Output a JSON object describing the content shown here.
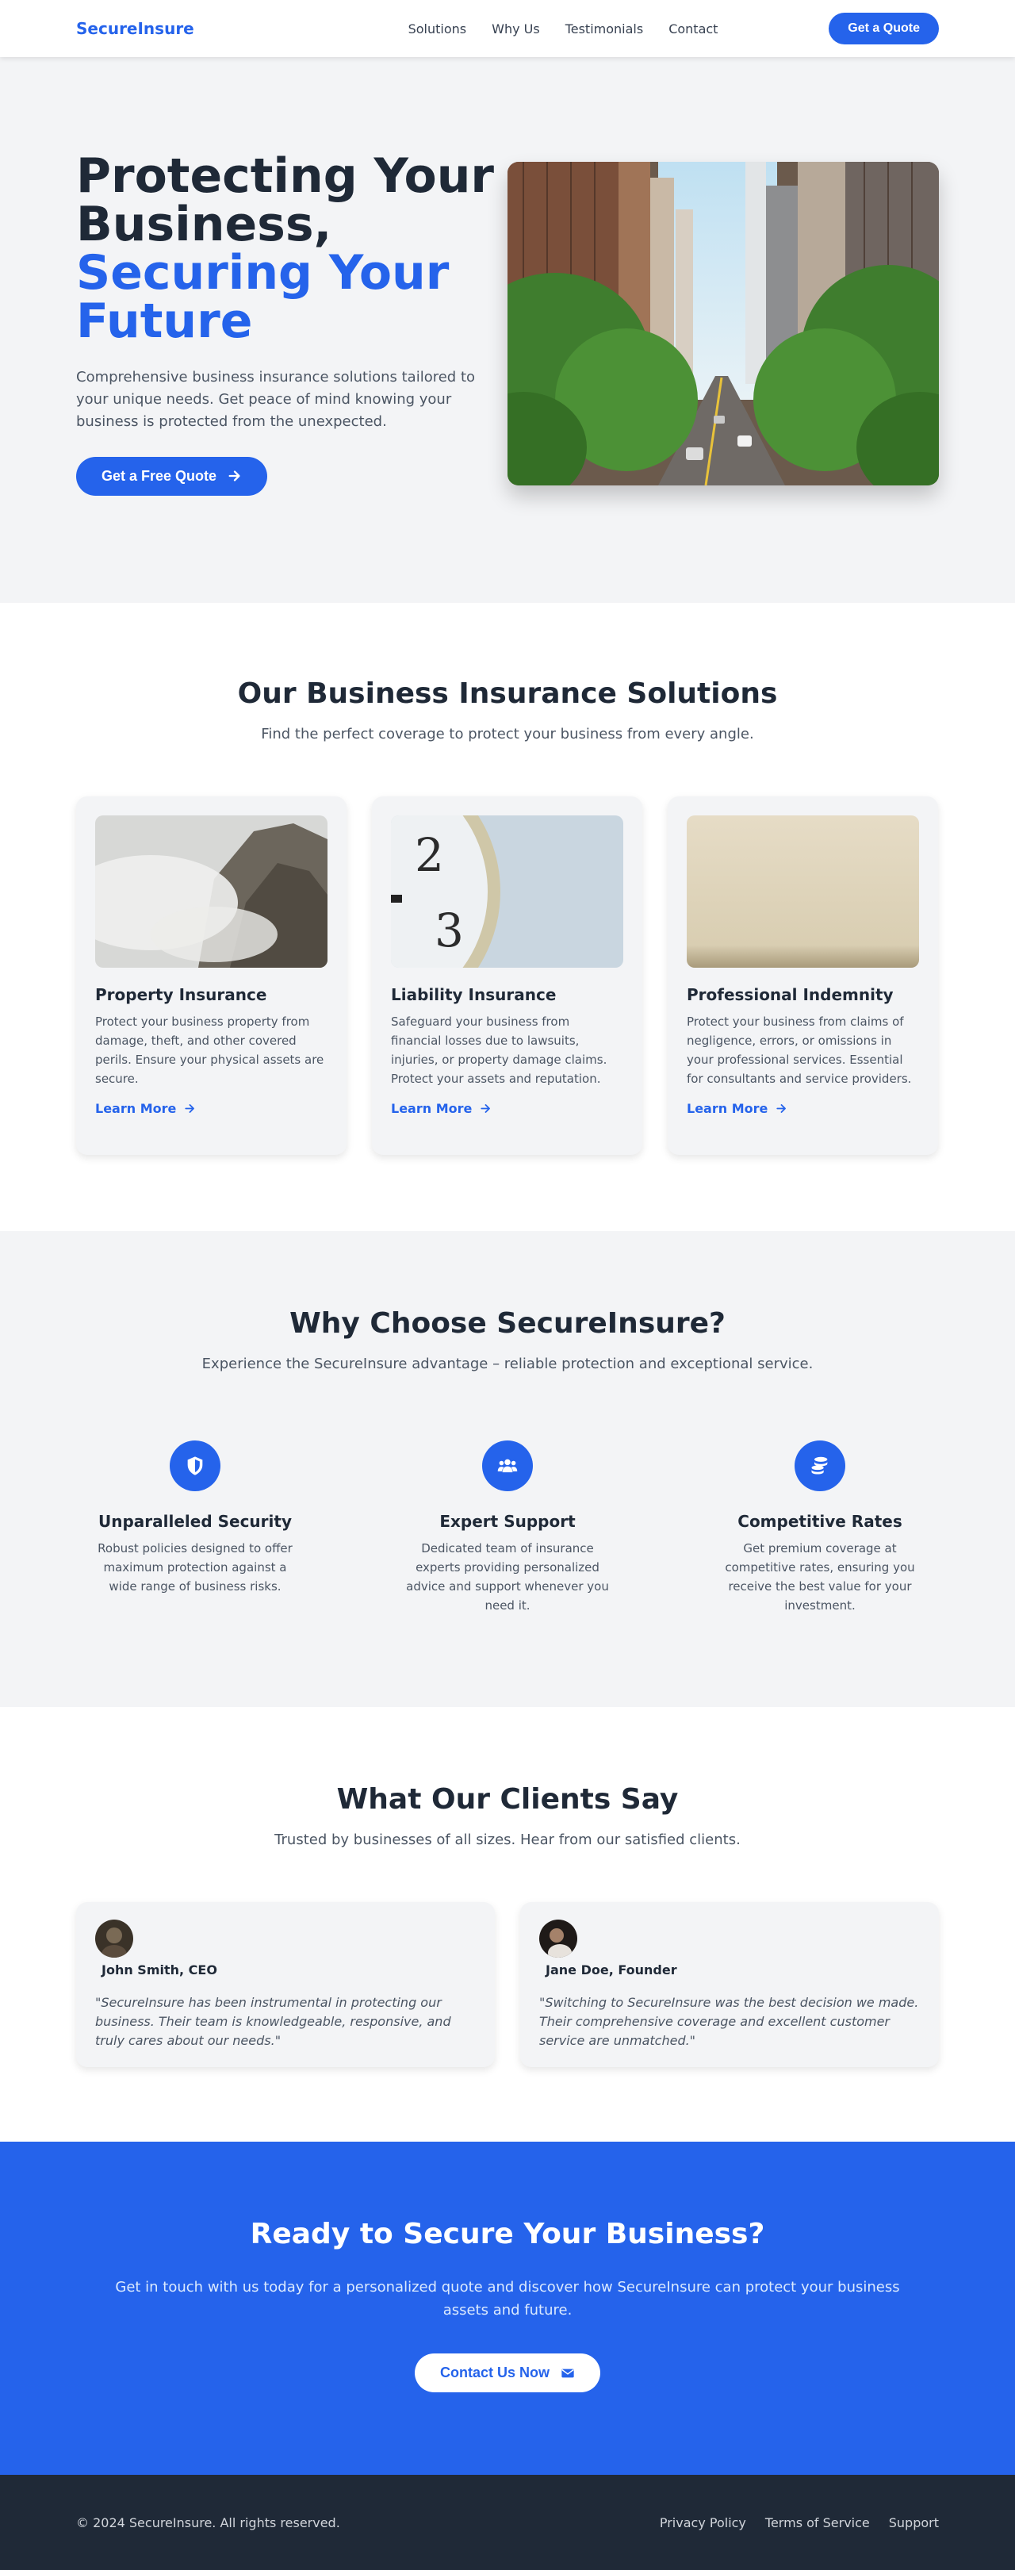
{
  "header": {
    "logo": "SecureInsure",
    "nav": [
      "Solutions",
      "Why Us",
      "Testimonials",
      "Contact"
    ],
    "cta_label": "Get a Quote"
  },
  "hero": {
    "title_line1": "Protecting Your",
    "title_line2": "Business,",
    "title_accent": "Securing Your Future",
    "subtitle": "Comprehensive business insurance solutions tailored to your unique needs. Get peace of mind knowing your business is protected from the unexpected.",
    "button_label": "Get a Free Quote",
    "button_icon": "arrow-right-icon"
  },
  "solutions": {
    "title": "Our Business Insurance Solutions",
    "subtitle": "Find the perfect coverage to protect your business from every angle.",
    "cards": [
      {
        "title": "Property Insurance",
        "text": "Protect your business property from damage, theft, and other covered perils. Ensure your physical assets are secure.",
        "link": "Learn More"
      },
      {
        "title": "Liability Insurance",
        "text": "Safeguard your business from financial losses due to lawsuits, injuries, or property damage claims. Protect your assets and reputation.",
        "link": "Learn More"
      },
      {
        "title": "Professional Indemnity",
        "text": "Protect your business from claims of negligence, errors, or omissions in your professional services. Essential for consultants and service providers.",
        "link": "Learn More"
      }
    ]
  },
  "why": {
    "title": "Why Choose SecureInsure?",
    "subtitle": "Experience the SecureInsure advantage – reliable protection and exceptional service.",
    "features": [
      {
        "icon": "shield-icon",
        "title": "Unparalleled Security",
        "text": "Robust policies designed to offer maximum protection against a wide range of business risks."
      },
      {
        "icon": "users-icon",
        "title": "Expert Support",
        "text": "Dedicated team of insurance experts providing personalized advice and support whenever you need it."
      },
      {
        "icon": "coins-icon",
        "title": "Competitive Rates",
        "text": "Get premium coverage at competitive rates, ensuring you receive the best value for your investment."
      }
    ]
  },
  "testimonials": {
    "title": "What Our Clients Say",
    "subtitle": "Trusted by businesses of all sizes. Hear from our satisfied clients.",
    "items": [
      {
        "name": "John Smith, CEO",
        "quote": "\"SecureInsure has been instrumental in protecting our business. Their team is knowledgeable, responsive, and truly cares about our needs.\""
      },
      {
        "name": "Jane Doe, Founder",
        "quote": "\"Switching to SecureInsure was the best decision we made. Their comprehensive coverage and excellent customer service are unmatched.\""
      }
    ]
  },
  "cta": {
    "title": "Ready to Secure Your Business?",
    "text": "Get in touch with us today for a personalized quote and discover how SecureInsure can protect your business assets and future.",
    "button_label": "Contact Us Now",
    "button_icon": "envelope-icon"
  },
  "footer": {
    "copyright": "© 2024 SecureInsure. All rights reserved.",
    "links": [
      "Privacy Policy",
      "Terms of Service",
      "Support"
    ]
  },
  "colors": {
    "primary": "#2563eb",
    "dark": "#1f2937",
    "light_bg": "#f3f4f6"
  }
}
